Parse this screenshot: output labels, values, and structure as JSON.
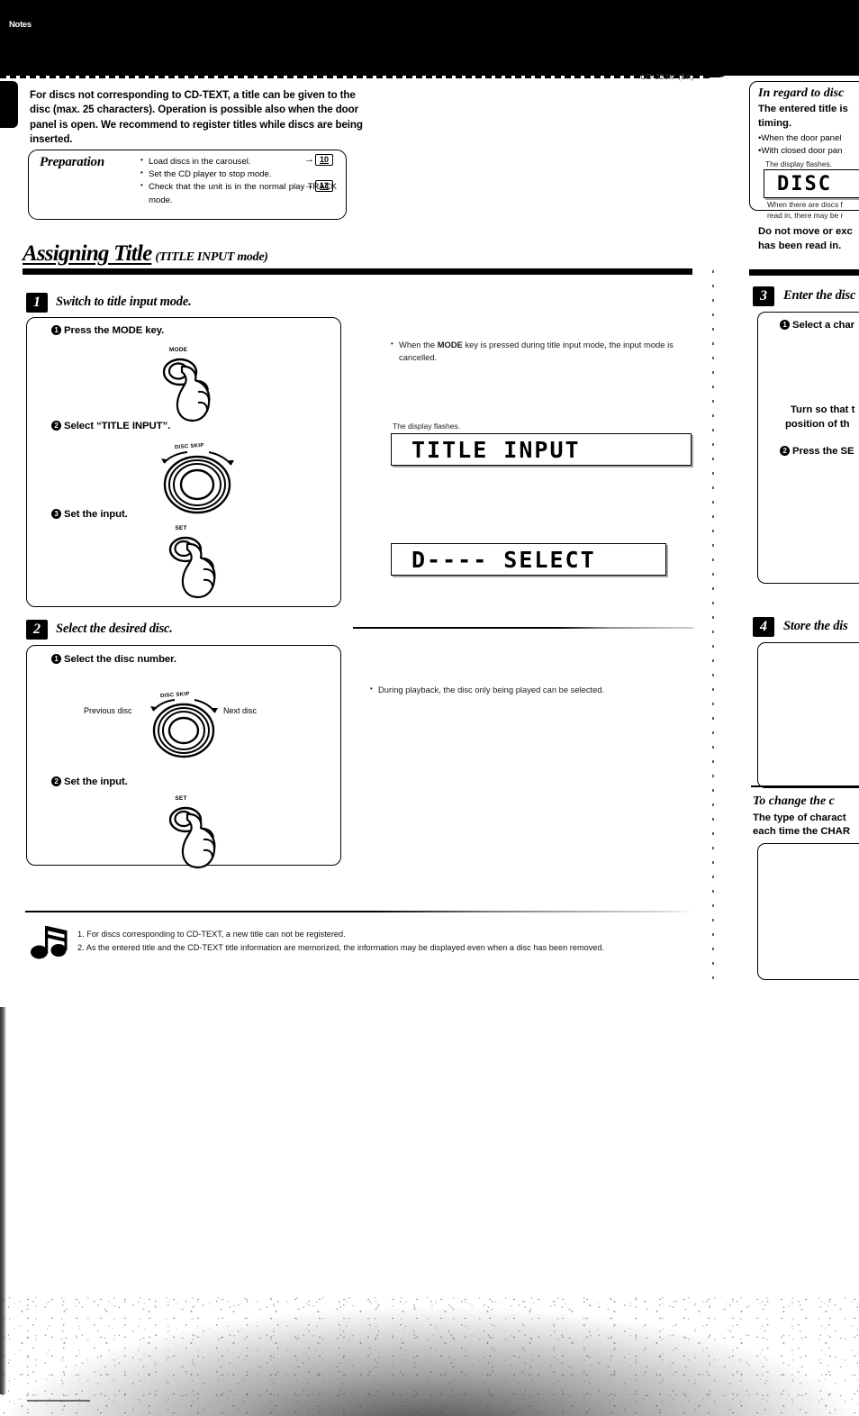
{
  "page": {
    "header_code": "CD-323M (En)"
  },
  "intro": {
    "paragraph": "For discs not corresponding to CD-TEXT, a title can be given to the disc (max. 25 characters). Operation is possible also when the door panel is open. We recommend to register titles while discs are being inserted."
  },
  "preparation": {
    "title": "Preparation",
    "items": [
      "Load discs in the carousel.",
      "Set the CD player to stop mode.",
      "Check that the unit is in the normal play TRACK mode."
    ],
    "page_refs": [
      "10",
      "13"
    ],
    "arrow": "→"
  },
  "section": {
    "title": "Assigning Title",
    "subtitle": "(TITLE INPUT mode)"
  },
  "steps": [
    {
      "number": "1",
      "title": "Switch to title input mode.",
      "substeps": [
        {
          "marker": "1",
          "label": "Press the MODE key."
        },
        {
          "marker": "2",
          "label": "Select “TITLE INPUT”."
        },
        {
          "marker": "3",
          "label": "Set the input."
        }
      ],
      "control_labels": {
        "mode_button": "MODE",
        "disc_skip_knob": "DISC SKIP",
        "set_button": "SET"
      }
    },
    {
      "number": "2",
      "title": "Select the desired disc.",
      "substeps": [
        {
          "marker": "1",
          "label": "Select the disc number."
        },
        {
          "marker": "2",
          "label": "Set the input."
        }
      ],
      "control_labels": {
        "disc_skip_knob": "DISC SKIP",
        "previous_disc": "Previous disc",
        "next_disc": "Next disc",
        "set_button": "SET"
      }
    }
  ],
  "annotations": {
    "mode_cancel": {
      "prefix": "When the ",
      "bold": "MODE",
      "suffix": " key is pressed during title input mode, the input mode is cancelled."
    },
    "display_flashes_caption": "The display flashes.",
    "playback_note": "During playback, the disc only being played can be selected."
  },
  "displays": [
    {
      "name": "title-input-display",
      "text": "TITLE INPUT"
    },
    {
      "name": "disc-select-display",
      "text": "D---- SELECT"
    }
  ],
  "notes": {
    "badge": "Notes",
    "items": [
      "1. For discs corresponding to CD-TEXT, a new title can not be registered.",
      "2. As the entered title and the CD-TEXT title information are memorized, the information may be displayed even when a disc has been removed."
    ]
  },
  "right_column": {
    "disc_info": {
      "heading": "In regard to disc ",
      "bold_line1": "The entered title is ",
      "bold_line2": "timing.",
      "bullet1": "When the door panel ",
      "bullet2": "With closed door pan",
      "display_caption": "The display flashes.",
      "display_text": "DISC",
      "small_line1": "When there are discs f",
      "small_line2": "read in, there may be r",
      "warn_line1": "Do not move or exc",
      "warn_line2": "has been read in."
    },
    "step3": {
      "number": "3",
      "title": "Enter the disc",
      "sub1": "Select a char",
      "bold1": "Turn so that t",
      "bold2": "position of th",
      "sub2": "Press the SE"
    },
    "step4": {
      "number": "4",
      "title": "Store the dis"
    },
    "change_char": {
      "heading": "To change the c",
      "line1": "The type of charact",
      "line2": "each time the CHAR"
    }
  },
  "colors": {
    "ink": "#000000",
    "paper": "#ffffff"
  }
}
